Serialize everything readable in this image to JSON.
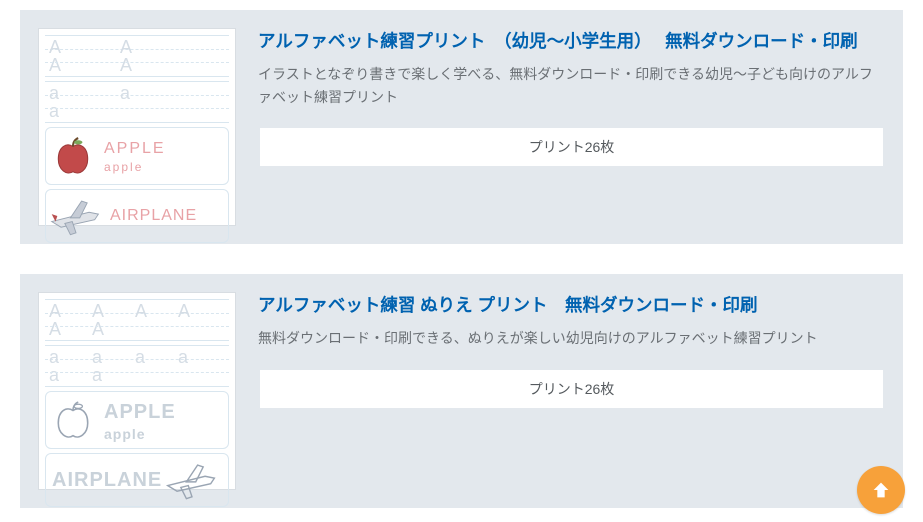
{
  "items": [
    {
      "title": "アルファベット練習プリント　（幼児〜小学生用）　 無料ダウンロード・印刷",
      "description": "イラストとなぞり書きで楽しく学べる、無料ダウンロード・印刷できる幼児〜子ども向けのアルファベット練習プリント",
      "count_label": "プリント26枚",
      "thumb": {
        "style": "color",
        "row1": "A A A A",
        "row2": "a a a",
        "word1_upper": "APPLE",
        "word1_lower": "apple",
        "word2_upper": "AIRPLANE"
      }
    },
    {
      "title": "アルファベット練習 ぬりえ プリント　無料ダウンロード・印刷",
      "description": "無料ダウンロード・印刷できる、ぬりえが楽しい幼児向けのアルファベット練習プリント",
      "count_label": "プリント26枚",
      "thumb": {
        "style": "outline",
        "row1": "A A A A A A",
        "row2": "a a a a a a",
        "word1_upper": "APPLE",
        "word1_lower": "apple",
        "word2_upper": "AIRPLANE"
      }
    }
  ],
  "icons": {
    "scroll_top": "arrow-up"
  }
}
